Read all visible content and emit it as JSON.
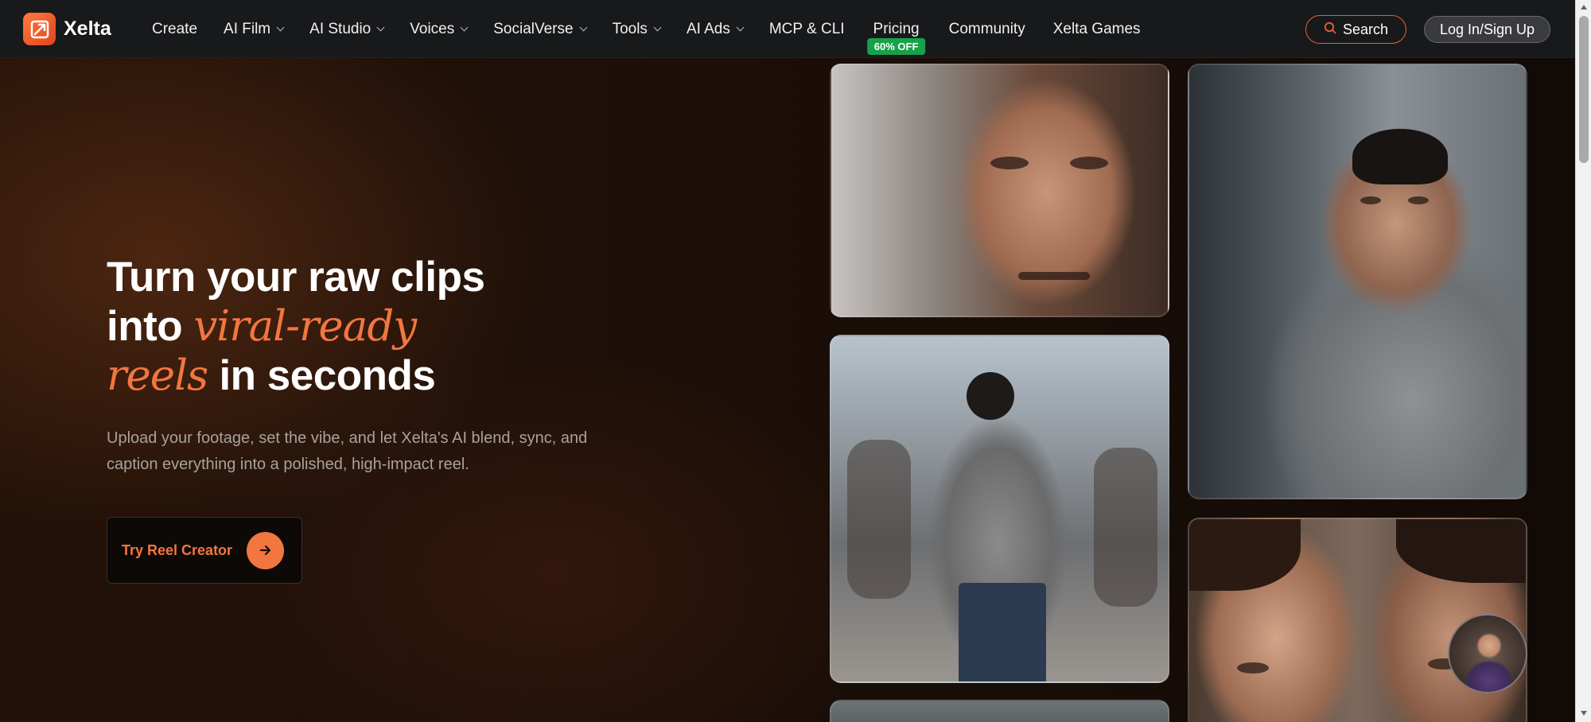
{
  "brand": {
    "name": "Xelta",
    "logo_icon": "xelta-logo-icon",
    "accent": "#f2763f"
  },
  "nav": {
    "items": [
      {
        "label": "Create",
        "dropdown": false
      },
      {
        "label": "AI Film",
        "dropdown": true
      },
      {
        "label": "AI Studio",
        "dropdown": true
      },
      {
        "label": "Voices",
        "dropdown": true
      },
      {
        "label": "SocialVerse",
        "dropdown": true
      },
      {
        "label": "Tools",
        "dropdown": true
      },
      {
        "label": "AI Ads",
        "dropdown": true
      },
      {
        "label": "MCP & CLI",
        "dropdown": false
      },
      {
        "label": "Pricing",
        "dropdown": false,
        "badge": "60% OFF"
      },
      {
        "label": "Community",
        "dropdown": false
      },
      {
        "label": "Xelta Games",
        "dropdown": false
      }
    ],
    "search_label": "Search",
    "login_label": "Log In/Sign Up"
  },
  "hero": {
    "line1": "Turn your raw clips",
    "line2_start": "into ",
    "line2_accent": "viral-ready",
    "line3_accent": "reels",
    "line3_end": " in seconds",
    "subtext": "Upload your footage, set the vibe, and let Xelta's AI blend, sync, and caption everything into a polished, high-impact reel.",
    "cta_label": "Try Reel Creator"
  },
  "colors": {
    "badge": "#17a24a",
    "search_border": "#e8622e",
    "cta_arrow_bg": "#f2763f"
  }
}
